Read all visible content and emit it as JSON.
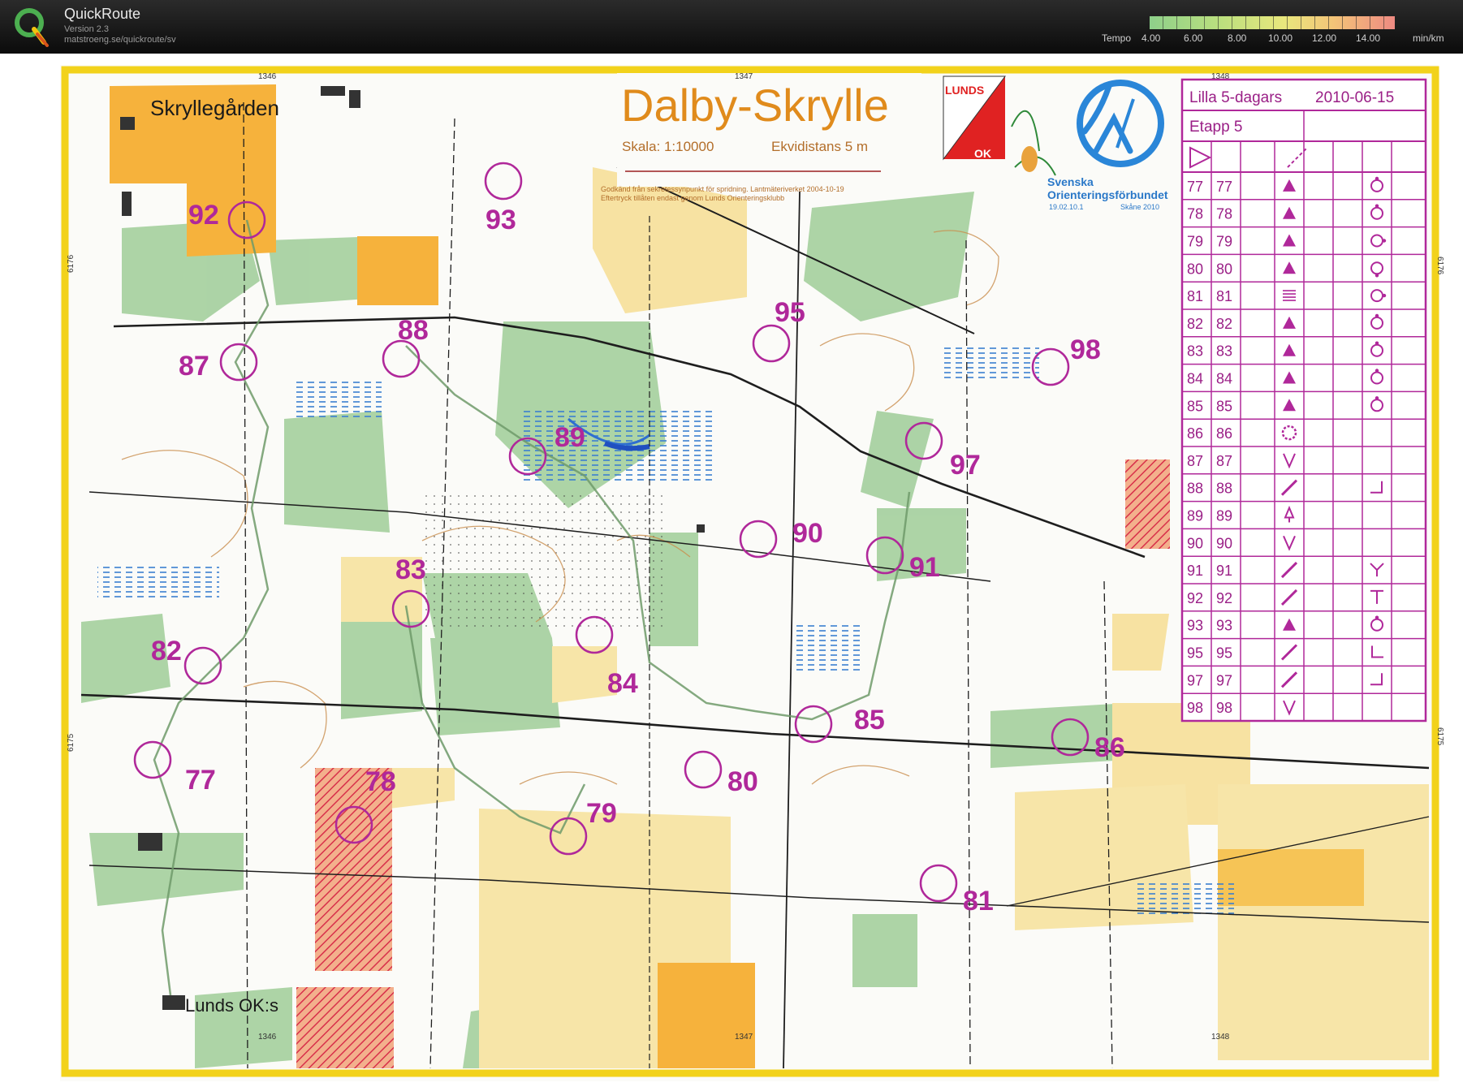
{
  "app": {
    "name": "QuickRoute",
    "version": "Version 2.3",
    "url": "matstroeng.se/quickroute/sv"
  },
  "tempo": {
    "label": "Tempo",
    "ticks": [
      "4.00",
      "6.00",
      "8.00",
      "10.00",
      "12.00",
      "14.00"
    ],
    "unit": "min/km"
  },
  "map": {
    "title": "Dalby-Skrylle",
    "scale": "Skala: 1:10000",
    "contour": "Ekvidistans 5 m",
    "fine_print_1": "Godkänd från sekretessynpunkt för spridning. Lantmäteriverket 2004-10-19",
    "fine_print_2": "Eftertryck tillåten endast genom Lunds Orienteringsklubb",
    "place_skryllegarden": "Skryllegården",
    "place_lunds": "Lunds OK:s",
    "grid_top": [
      "1346",
      "1347",
      "1348"
    ],
    "grid_side": [
      "6176",
      "6175"
    ],
    "club_logo_top": "LUNDS",
    "club_logo_bottom": "OK",
    "federation_1": "Svenska",
    "federation_2": "Orienteringsförbundet",
    "federation_code": "19.02.10.1",
    "federation_year": "Skåne 2010",
    "colors": {
      "frame": "#f2d21b",
      "control": "#b0289a",
      "vegetation": "#8fc48d",
      "open_land": "#f7d88a",
      "road": "#222222"
    }
  },
  "controls": [
    "77",
    "78",
    "79",
    "80",
    "81",
    "82",
    "83",
    "84",
    "85",
    "86",
    "87",
    "88",
    "89",
    "90",
    "91",
    "92",
    "93",
    "95",
    "97",
    "98"
  ],
  "description_sheet": {
    "event": "Lilla 5-dagars",
    "date": "2010-06-15",
    "stage": "Etapp 5",
    "rows": [
      {
        "n": "77",
        "code": "77",
        "feature": "triangle",
        "appear": "circle-top"
      },
      {
        "n": "78",
        "code": "78",
        "feature": "triangle",
        "appear": "circle-top"
      },
      {
        "n": "79",
        "code": "79",
        "feature": "triangle",
        "appear": "circle-right"
      },
      {
        "n": "80",
        "code": "80",
        "feature": "triangle",
        "appear": "circle-bottom"
      },
      {
        "n": "81",
        "code": "81",
        "feature": "lines",
        "appear": "circle-right"
      },
      {
        "n": "82",
        "code": "82",
        "feature": "triangle",
        "appear": "circle-top"
      },
      {
        "n": "83",
        "code": "83",
        "feature": "triangle",
        "appear": "circle-top"
      },
      {
        "n": "84",
        "code": "84",
        "feature": "triangle",
        "appear": "circle-top"
      },
      {
        "n": "85",
        "code": "85",
        "feature": "triangle",
        "appear": "circle-top"
      },
      {
        "n": "86",
        "code": "86",
        "feature": "ring",
        "appear": ""
      },
      {
        "n": "87",
        "code": "87",
        "feature": "v",
        "appear": ""
      },
      {
        "n": "88",
        "code": "88",
        "feature": "slash",
        "appear": "corner-left"
      },
      {
        "n": "89",
        "code": "89",
        "feature": "arrow",
        "appear": ""
      },
      {
        "n": "90",
        "code": "90",
        "feature": "v",
        "appear": ""
      },
      {
        "n": "91",
        "code": "91",
        "feature": "slash",
        "appear": "y-junction"
      },
      {
        "n": "92",
        "code": "92",
        "feature": "slash",
        "appear": "t-junction"
      },
      {
        "n": "93",
        "code": "93",
        "feature": "triangle",
        "appear": "circle-top"
      },
      {
        "n": "95",
        "code": "95",
        "feature": "slash",
        "appear": "corner-right"
      },
      {
        "n": "97",
        "code": "97",
        "feature": "slash",
        "appear": "corner-left"
      },
      {
        "n": "98",
        "code": "98",
        "feature": "v",
        "appear": ""
      }
    ]
  }
}
